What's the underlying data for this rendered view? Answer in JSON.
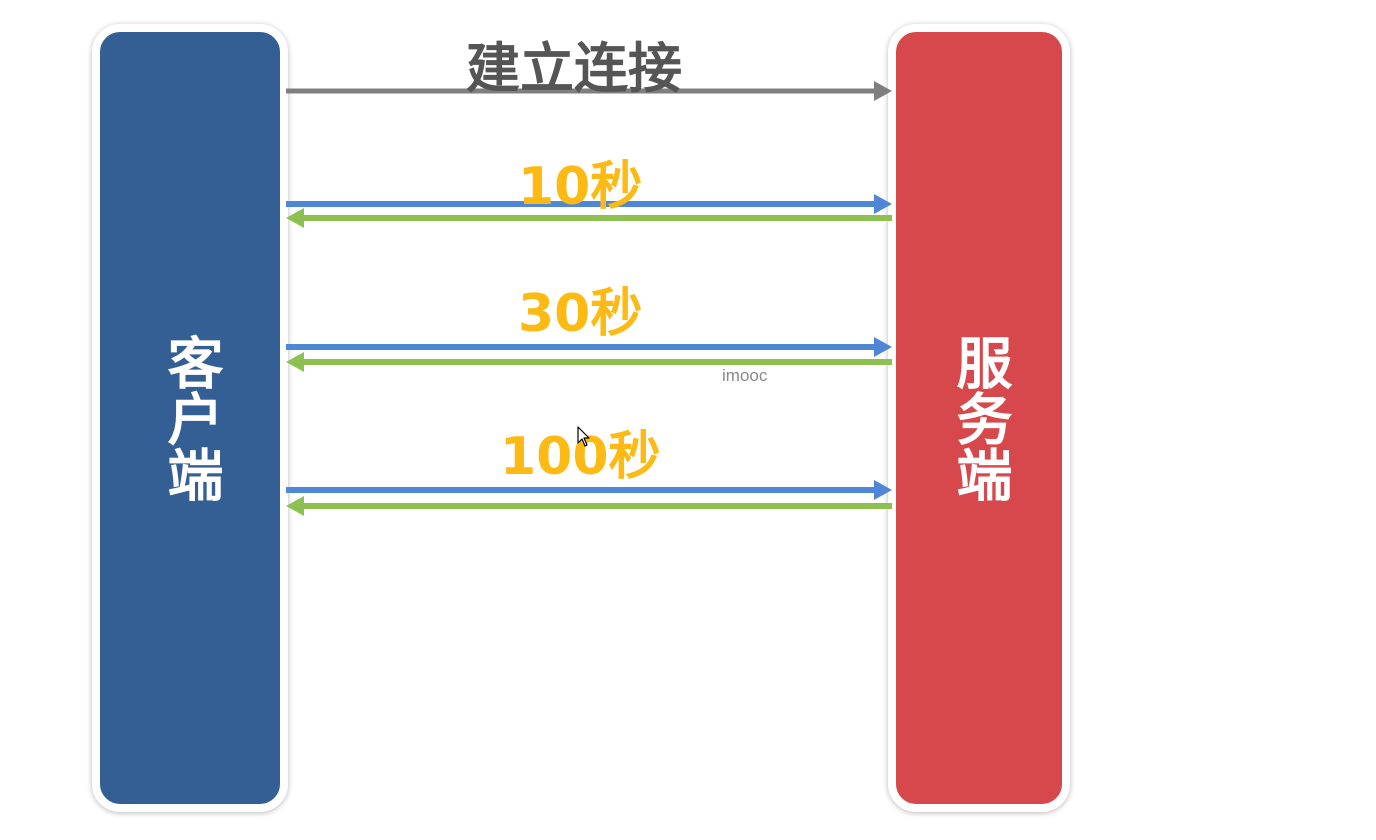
{
  "client": {
    "label": "客户端",
    "color": "#345f95"
  },
  "server": {
    "label": "服务端",
    "color": "#d6484b"
  },
  "connection": {
    "label": "建立连接",
    "color": "#7f7f7f"
  },
  "intervals": [
    {
      "label": "10秒"
    },
    {
      "label": "30秒"
    },
    {
      "label": "100秒"
    }
  ],
  "colors": {
    "request_arrow": "#4f86d6",
    "response_arrow": "#8cc152",
    "interval_text": "#fdb914"
  },
  "watermark": "imooc",
  "icons": {
    "cursor": "mouse-pointer-icon"
  }
}
